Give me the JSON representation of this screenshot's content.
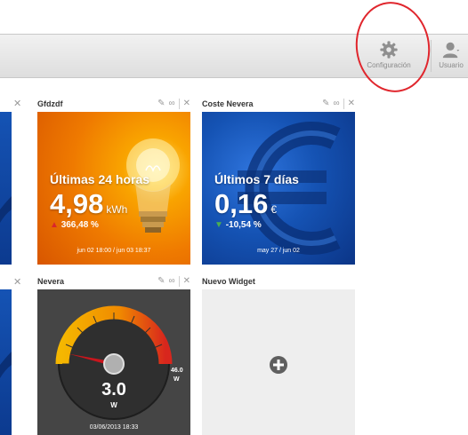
{
  "toolbar": {
    "configuracion_label": "Configuración",
    "usuario_label": "Usuario"
  },
  "widgets": [
    {
      "title": "Gfdzdf",
      "period_label": "Últimas 24 horas",
      "value": "4,98",
      "unit": "kWh",
      "delta": "366,48 %",
      "delta_direction": "up",
      "range": "jun 02 18:00 / jun 03 18:37"
    },
    {
      "title": "Coste Nevera",
      "period_label": "Últimos 7 días",
      "value": "0,16",
      "unit": "€",
      "delta": "-10,54 %",
      "delta_direction": "down",
      "range": "may 27 / jun 02"
    },
    {
      "title": "Nevera",
      "gauge_value": "3.0",
      "gauge_unit": "W",
      "gauge_max": "46.0",
      "gauge_max_unit": "W",
      "gauge_fraction": 0.07,
      "timestamp": "03/06/2013 18:33"
    },
    {
      "title": "Nuevo Widget"
    }
  ],
  "colors": {
    "annotation": "#e0262d",
    "delta_up": "#d9262b",
    "delta_down": "#4caf50",
    "widget1_bg": "#f08a00",
    "widget2_bg": "#0d49a8",
    "gauge_bg": "#454545",
    "placeholder_bg": "#eeeeee"
  },
  "icons": {
    "settings": "gear-icon",
    "user": "user-icon",
    "edit": "pencil-icon",
    "link": "link-icon",
    "close": "close-icon",
    "add": "plus-circle-icon"
  }
}
